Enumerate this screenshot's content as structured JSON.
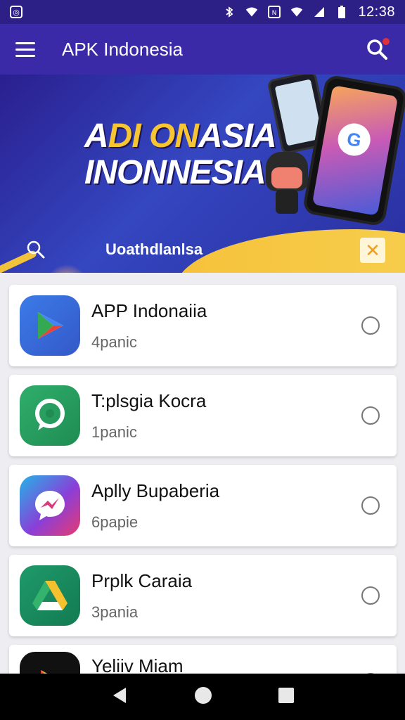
{
  "status_bar": {
    "time": "12:38",
    "icons": [
      "app-notification-icon",
      "bluetooth-icon",
      "wifi-icon",
      "nfc-icon",
      "signal-icon",
      "battery-icon"
    ]
  },
  "app_bar": {
    "title": "APK Indonesia",
    "menu_icon": "hamburger-menu-icon",
    "search_icon": "search-icon",
    "colors": {
      "status": "#2c1f86",
      "appbar": "#3a2aa8"
    }
  },
  "banner": {
    "headline_line1_part1": "A",
    "headline_line1_highlight": "DI ON",
    "headline_line1_part2": "ASIA",
    "headline_line2": "INONNESIA",
    "caption": "Uoathdlanlsa",
    "close_label": "✕",
    "colors": {
      "accent": "#f7c531"
    }
  },
  "apps": [
    {
      "title": "APP Indonaiia",
      "subtitle": "4panic",
      "icon": "play-store-icon"
    },
    {
      "title": "T:plsgia Kocra",
      "subtitle": "1panic",
      "icon": "chat-bubble-icon"
    },
    {
      "title": "Aplly  Bupaberia",
      "subtitle": "6papie",
      "icon": "messenger-icon"
    },
    {
      "title": "Prplk Caraia",
      "subtitle": "3pania",
      "icon": "drive-icon"
    },
    {
      "title": "Yeliiv Miam",
      "subtitle": "",
      "icon": "video-play-icon"
    }
  ],
  "nav": {
    "back": "back-icon",
    "home": "home-icon",
    "recents": "recents-icon"
  }
}
